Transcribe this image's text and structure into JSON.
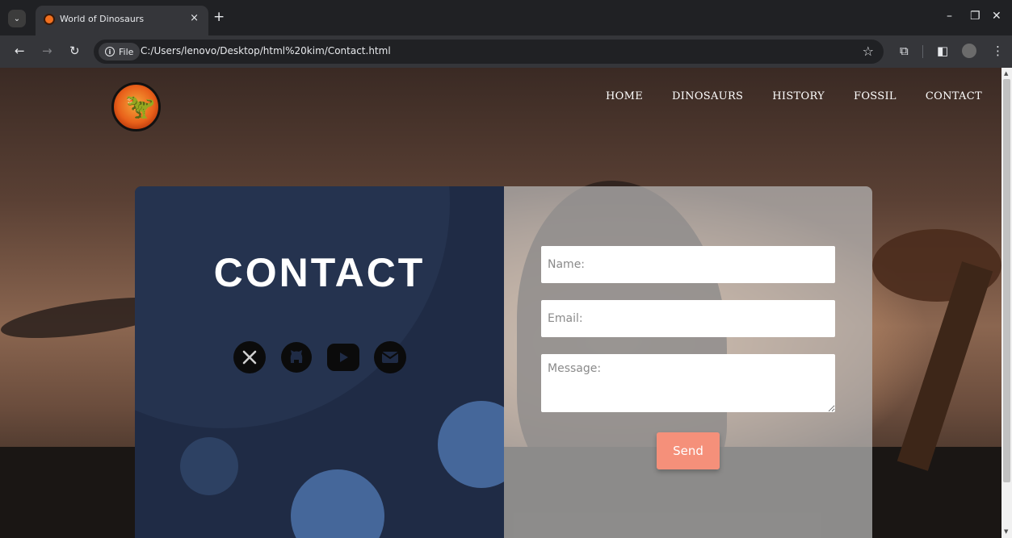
{
  "browser": {
    "tab_title": "World of Dinosaurs",
    "tab_close": "×",
    "new_tab": "+",
    "window_controls": {
      "minimize": "–",
      "restore": "❐",
      "close": "✕"
    },
    "site_info_label": "File",
    "url": "C:/Users/lenovo/Desktop/html%20kim/Contact.html"
  },
  "site": {
    "nav": [
      "HOME",
      "DINOSAURS",
      "HISTORY",
      "FOSSIL",
      "CONTACT"
    ]
  },
  "contact": {
    "title": "CONTACT",
    "socials": [
      "x-icon",
      "github-icon",
      "youtube-icon",
      "email-icon"
    ],
    "form": {
      "name_placeholder": "Name:",
      "email_placeholder": "Email:",
      "message_placeholder": "Message:",
      "send_label": "Send"
    }
  },
  "colors": {
    "card_left": "#1f2b45",
    "card_right": "#b9b9b9",
    "circle": "#45679a",
    "send_button": "#f5907a",
    "logo": "#e8601a"
  }
}
